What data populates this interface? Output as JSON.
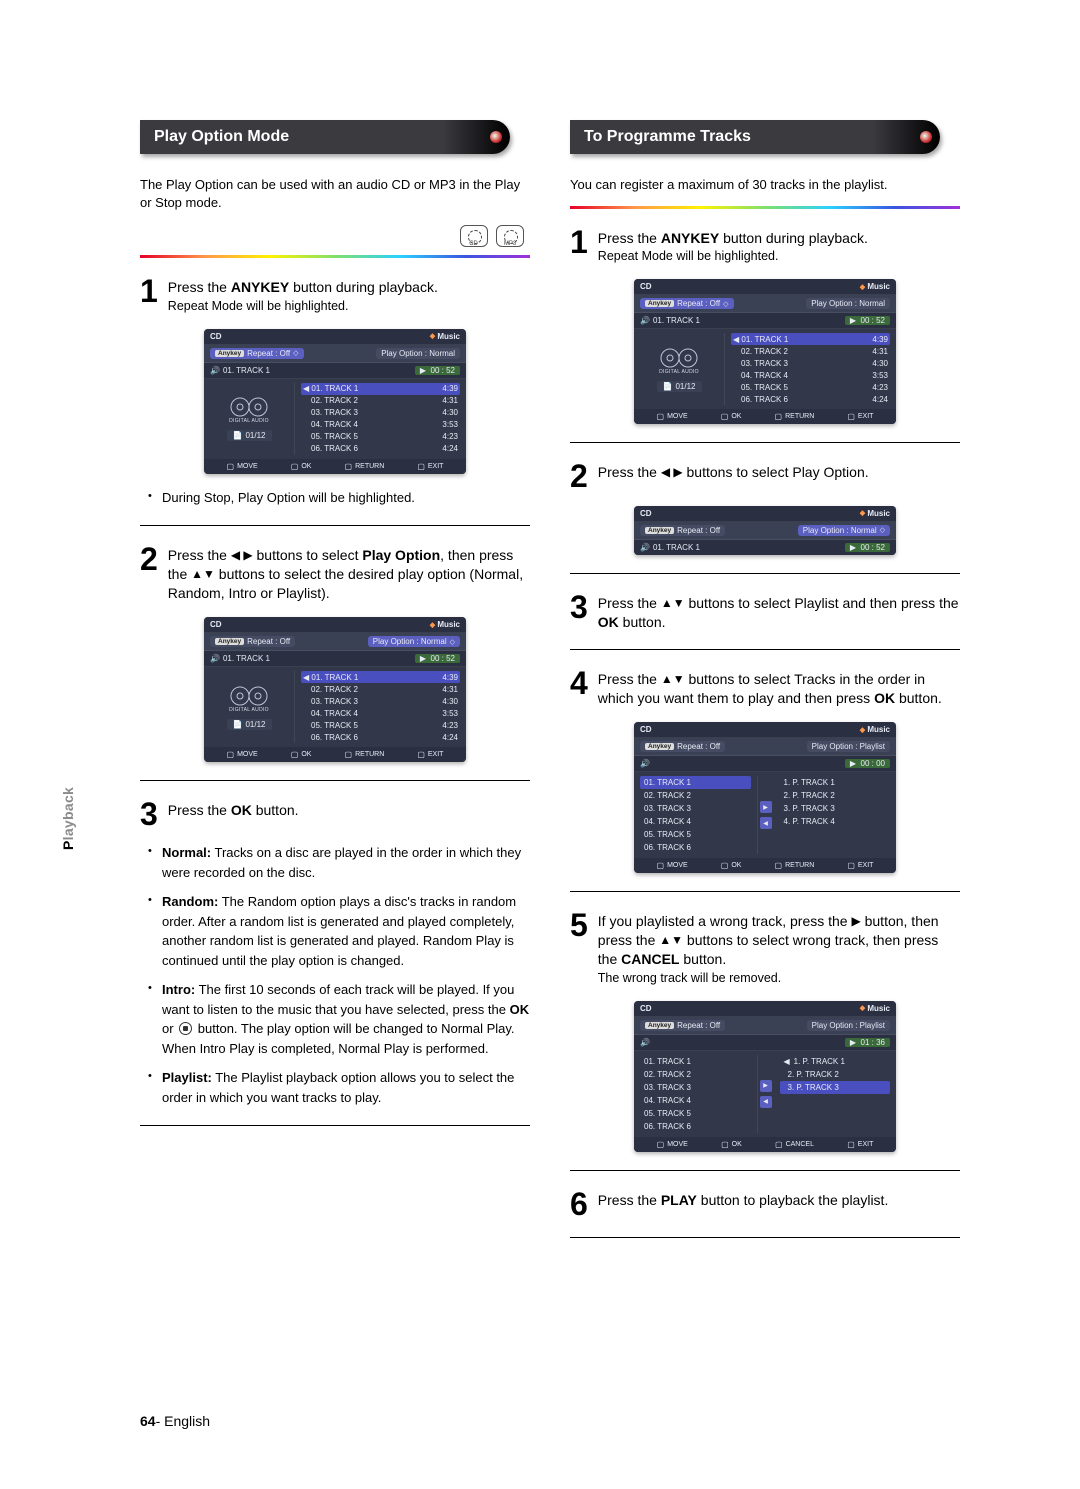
{
  "sideTab": {
    "prefix": "P",
    "rest": "layback"
  },
  "page": {
    "num": "64",
    "lang": "English"
  },
  "arrows": {
    "lr": "◀ ▶",
    "ud": "▲▼",
    "r": "▶"
  },
  "discIcons": {
    "cd": "CD",
    "mp3": "MP3"
  },
  "left": {
    "heading": "Play Option Mode",
    "intro": "The Play Option can be used with an audio CD or MP3 in the Play or Stop mode.",
    "step1": {
      "num": "1",
      "t1": "Press the ",
      "t2": "ANYKEY",
      "t3": " button during playback.",
      "sub": "Repeat Mode will be highlighted."
    },
    "note1": "During Stop, Play Option will be highlighted.",
    "step2": {
      "num": "2",
      "t1": "Press the ",
      "t2": " buttons to select ",
      "t3": "Play Option",
      "t4": ", then press the ",
      "t5": " buttons to select the desired play option (Normal, Random, Intro or Playlist)."
    },
    "step3": {
      "num": "3",
      "t1": "Press the ",
      "t2": "OK",
      "t3": " button."
    },
    "defs": {
      "normal": {
        "h": "Normal:",
        "t": " Tracks on a disc are played in the order in which they were recorded on the disc."
      },
      "random": {
        "h": "Random:",
        "t": " The Random option plays a disc's tracks in random order. After a random list is generated and played completely, another random list is generated and played. Random Play is continued until the play option is changed."
      },
      "intro": {
        "h": "Intro:",
        "t1": " The first 10 seconds of each track will be played. If you want to listen to the music that you have selected, press the ",
        "t2": "OK",
        "t3": " or ",
        "t4": " button. The play option will be changed to Normal Play. When Intro Play is completed, Normal Play is performed."
      },
      "playlist": {
        "h": "Playlist:",
        "t": " The Playlist playback option allows you to select the order in which you want tracks to play."
      }
    }
  },
  "right": {
    "heading": "To Programme Tracks",
    "intro": "You can register a maximum of 30 tracks in the playlist.",
    "step1": {
      "num": "1",
      "t1": "Press the ",
      "t2": "ANYKEY",
      "t3": " button during playback.",
      "sub": "Repeat Mode will be highlighted."
    },
    "step2": {
      "num": "2",
      "t1": "Press the ",
      "t2": " buttons to select Play Option."
    },
    "step3": {
      "num": "3",
      "t1": "Press the ",
      "t2": " buttons to select Playlist and then press the ",
      "t3": "OK",
      "t4": " button."
    },
    "step4": {
      "num": "4",
      "t1": "Press the ",
      "t2": " buttons to select Tracks in the order in which you want them to play and then press ",
      "t3": "OK",
      "t4": " button."
    },
    "step5": {
      "num": "5",
      "t1": "If you playlisted a wrong track, press the ",
      "t2": " button, then press the ",
      "t3": " buttons to select wrong track, then press the ",
      "t4": "CANCEL",
      "t5": " button.",
      "sub": "The wrong track will be removed."
    },
    "step6": {
      "num": "6",
      "t1": "Press the ",
      "t2": "PLAY",
      "t3": " button to playback the playlist."
    }
  },
  "osd": {
    "title": "CD",
    "musicLabel": "Music",
    "anykey": "Anykey",
    "repeat": "Repeat : Off",
    "playOptNormal": "Play Option : Normal",
    "playOptPlaylist": "Play Option : Playlist",
    "curTrack": "01. TRACK 1",
    "time": "00 : 52",
    "plTime": "00 : 00",
    "plCancelTime": "01 : 36",
    "counter": "01/12",
    "logoLabel": "DIGITAL AUDIO",
    "tracks": [
      {
        "n": "01. TRACK 1",
        "d": "4:39"
      },
      {
        "n": "02. TRACK 2",
        "d": "4:31"
      },
      {
        "n": "03. TRACK 3",
        "d": "4:30"
      },
      {
        "n": "04. TRACK 4",
        "d": "3:53"
      },
      {
        "n": "05. TRACK 5",
        "d": "4:23"
      },
      {
        "n": "06. TRACK 6",
        "d": "4:24"
      }
    ],
    "srcList": [
      "01. TRACK 1",
      "02. TRACK 2",
      "03. TRACK 3",
      "04. TRACK 4",
      "05. TRACK 5",
      "06. TRACK 6"
    ],
    "plList4": [
      "1. P. TRACK 1",
      "2. P. TRACK 2",
      "3. P. TRACK 3",
      "4. P. TRACK 4"
    ],
    "plList3": [
      "1. P. TRACK 1",
      "2. P. TRACK 2",
      "3. P. TRACK 3"
    ],
    "keys": {
      "move": "MOVE",
      "ok": "OK",
      "return": "RETURN",
      "exit": "EXIT",
      "cancel": "CANCEL"
    }
  }
}
